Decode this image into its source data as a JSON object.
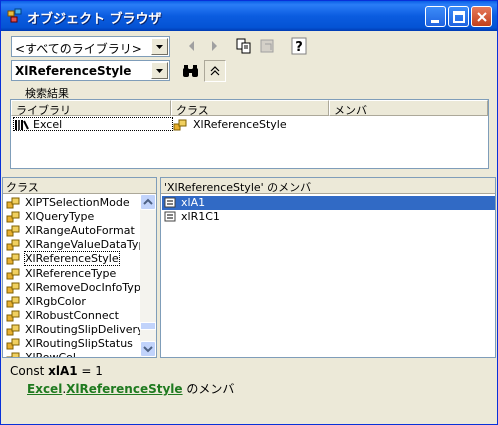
{
  "window": {
    "title": "オブジェクト ブラウザ",
    "accent": "#0a5fe6"
  },
  "toolbar": {
    "library_value": "<すべてのライブラリ>",
    "search_value": "XlReferenceStyle",
    "icons": [
      "back-icon",
      "forward-icon",
      "copy-icon",
      "view-definition-icon",
      "help-icon",
      "binoculars-search-icon",
      "collapse-icon"
    ]
  },
  "search_results": {
    "label": "検索結果",
    "columns": [
      "ライブラリ",
      "クラス",
      "メンバ"
    ],
    "rows": [
      {
        "library": "Excel",
        "class": "XlReferenceStyle",
        "member": ""
      }
    ]
  },
  "classes": {
    "header": "クラス",
    "items": [
      "XlPTSelectionMode",
      "XlQueryType",
      "XlRangeAutoFormat",
      "XlRangeValueDataTyp",
      "XlReferenceStyle",
      "XlReferenceType",
      "XlRemoveDocInfoType",
      "XlRgbColor",
      "XlRobustConnect",
      "XlRoutingSlipDelivery",
      "XlRoutingSlipStatus",
      "XlRowCol"
    ],
    "focused_index": 4
  },
  "members": {
    "header": "'XlReferenceStyle' のメンバ",
    "items": [
      "xlA1",
      "xlR1C1"
    ],
    "selected_index": 0
  },
  "details": {
    "const_prefix": "Const ",
    "const_name": "xlA1",
    "const_suffix": " = 1",
    "library_link": "Excel",
    "separator": ".",
    "class_link": "XlReferenceStyle",
    "suffix": " のメンバ"
  }
}
